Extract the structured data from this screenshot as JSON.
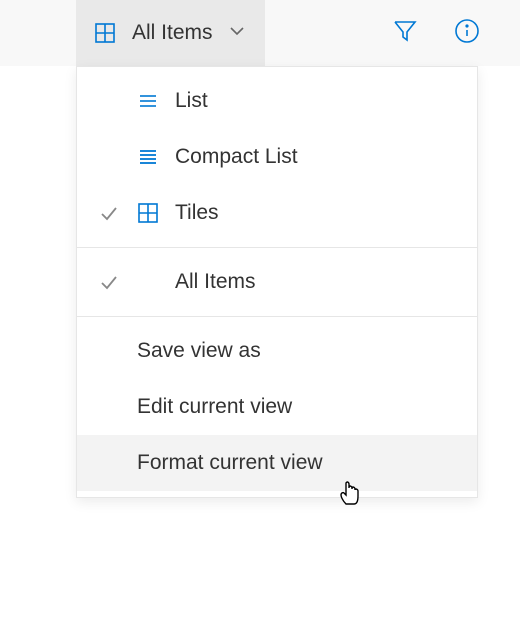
{
  "toolbar": {
    "view_selector_label": "All Items"
  },
  "menu": {
    "layouts": {
      "list": "List",
      "compact_list": "Compact List",
      "tiles": "Tiles",
      "selected_layout": "tiles"
    },
    "views": {
      "all_items": "All Items",
      "selected_view": "all_items"
    },
    "actions": {
      "save_as": "Save view as",
      "edit": "Edit current view",
      "format": "Format current view"
    }
  },
  "colors": {
    "accent": "#0078d4"
  }
}
